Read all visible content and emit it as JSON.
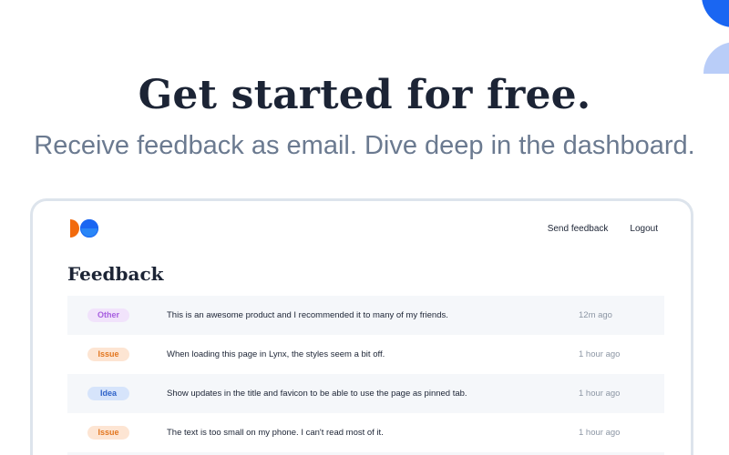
{
  "hero": {
    "title": "Get started for free.",
    "subtitle": "Receive feedback as email. Dive deep in the dashboard."
  },
  "nav": {
    "send_feedback": "Send feedback",
    "logout": "Logout"
  },
  "section_title": "Feedback",
  "feedback": [
    {
      "type": "Other",
      "message": "This is an awesome product and I recommended it to many of my friends.",
      "time": "12m ago"
    },
    {
      "type": "Issue",
      "message": "When loading this page in Lynx, the styles seem a bit off.",
      "time": "1 hour ago"
    },
    {
      "type": "Idea",
      "message": "Show updates in the title and favicon to be able to use the page as pinned tab.",
      "time": "1 hour ago"
    },
    {
      "type": "Issue",
      "message": "The text is too small on my phone. I can't read most of it.",
      "time": "1 hour ago"
    }
  ],
  "colors": {
    "brand_blue": "#1a66f2",
    "brand_orange": "#f26a0c",
    "badge_other_bg": "#f1e3fb",
    "badge_other_text": "#a75ee0",
    "badge_issue_bg": "#fde5d3",
    "badge_issue_text": "#e2761f",
    "badge_idea_bg": "#d6e4fb",
    "badge_idea_text": "#2f63c9"
  },
  "icons": {
    "logo": "brand-logo-icon"
  }
}
